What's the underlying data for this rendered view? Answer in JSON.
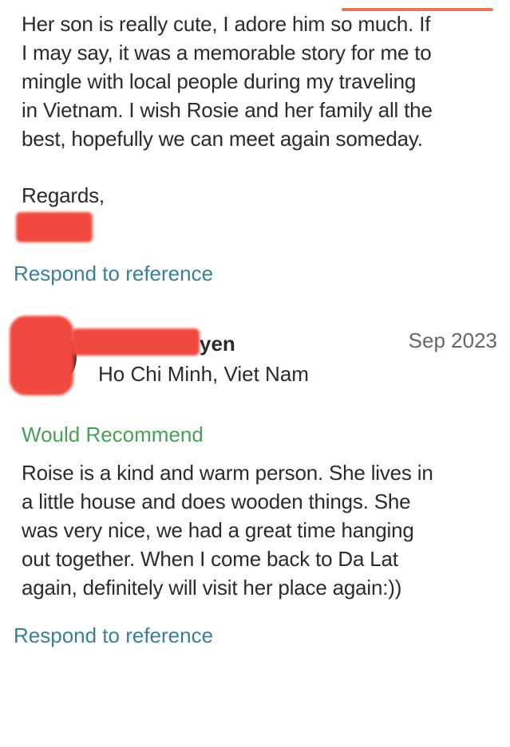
{
  "reference_1": {
    "lines": [
      "Her son is really cute, I adore him so much. If",
      "I may say, it was a memorable story for me to",
      "mingle with local people during my traveling",
      "in Vietnam. I wish Rosie and her family all the",
      "best, hopefully we can meet again someday."
    ],
    "closing": "Regards,",
    "respond_label": "Respond to reference"
  },
  "reference_2": {
    "author_visible": "yen",
    "location": "Ho Chi Minh, Viet Nam",
    "date": "Sep 2023",
    "recommendation": "Would Recommend",
    "lines": [
      "Roise is a kind and warm person. She lives in",
      "a little house and does wooden things. She",
      "was very nice, we had a great time hanging",
      "out together. When I come back to Da Lat",
      "again, definitely will visit her place again:))"
    ],
    "respond_label": "Respond to reference"
  },
  "colors": {
    "text": "#2b2b2b",
    "link": "#3c7f94",
    "recommend": "#4a9e58",
    "redaction": "#f0493f",
    "date": "#666666"
  }
}
